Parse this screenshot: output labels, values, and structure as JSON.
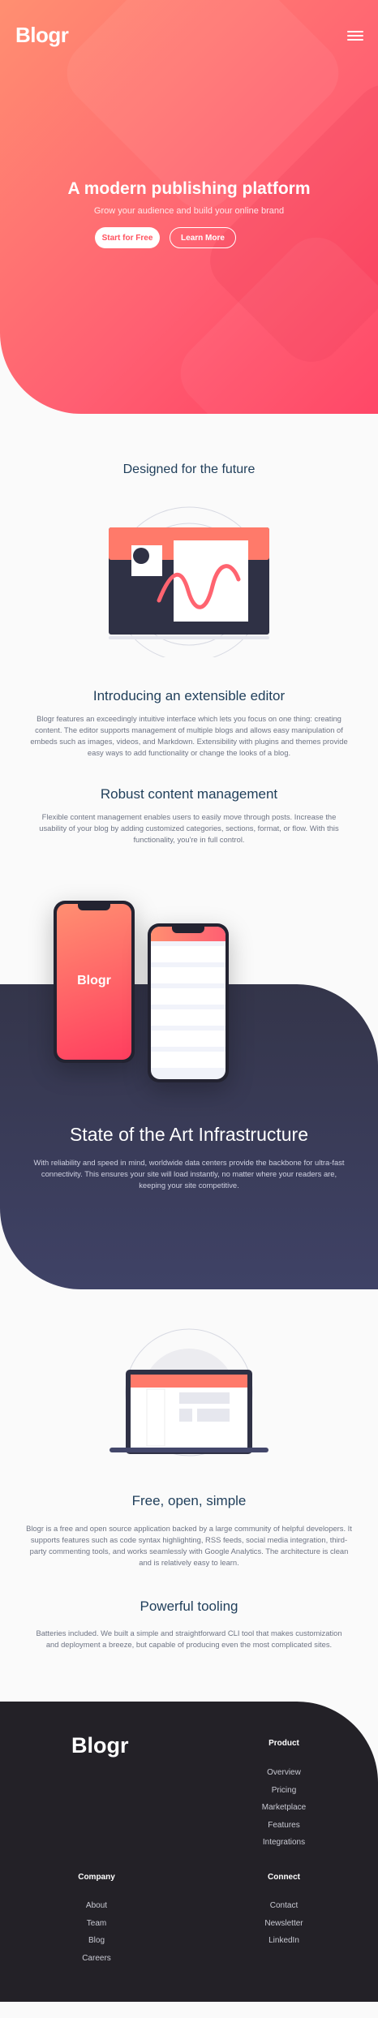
{
  "header": {
    "logo": "Blogr",
    "menu_icon": "hamburger-icon"
  },
  "hero": {
    "title": "A modern publishing platform",
    "subtitle": "Grow your audience and build your online brand",
    "start_label": "Start for Free",
    "learn_label": "Learn More"
  },
  "future": {
    "title": "Designed for the future",
    "editor_title": "Introducing an extensible editor",
    "editor_text": "Blogr features an exceedingly intuitive interface which lets you focus on one thing: creating content. The editor supports management of multiple blogs and allows easy manipulation of embeds such as images, videos, and Markdown. Extensibility with plugins and themes provide easy ways to add functionality or change the looks of a blog.",
    "content_title": "Robust content management",
    "content_text": "Flexible content management enables users to easily move through posts. Increase the usability of your blog by adding customized categories, sections, format, or flow. With this functionality, you're in full control."
  },
  "infra": {
    "phone_logo": "Blogr",
    "title": "State of the Art Infrastructure",
    "text": "With reliability and speed in mind, worldwide data centers provide the backbone for ultra-fast connectivity. This ensures your site will load instantly, no matter where your readers are, keeping your site competitive."
  },
  "free": {
    "title": "Free, open, simple",
    "text": "Blogr is a free and open source application backed by a large community of helpful developers. It supports features such as code syntax highlighting, RSS feeds, social media integration, third-party commenting tools, and works seamlessly with Google Analytics. The architecture is clean and is relatively easy to learn.",
    "tooling_title": "Powerful tooling",
    "tooling_text": "Batteries included. We built a simple and straightforward CLI tool that makes customization and deployment a breeze, but capable of producing even the most complicated sites."
  },
  "footer": {
    "logo": "Blogr",
    "product_heading": "Product",
    "product_links": [
      "Overview",
      "Pricing",
      "Marketplace",
      "Features",
      "Integrations"
    ],
    "company_heading": "Company",
    "company_links": [
      "About",
      "Team",
      "Blog",
      "Careers"
    ],
    "connect_heading": "Connect",
    "connect_links": [
      "Contact",
      "Newsletter",
      "LinkedIn"
    ]
  },
  "colors": {
    "accent_start": "#ff8f71",
    "accent_end": "#ff3e5f",
    "heading": "#1f3e5a",
    "dark_band": "#3f4266",
    "footer": "#232127"
  }
}
